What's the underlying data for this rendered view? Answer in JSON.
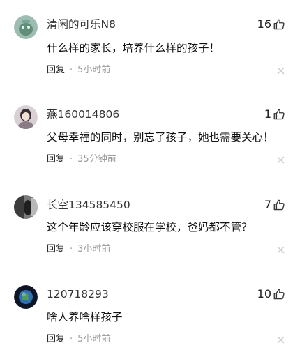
{
  "comments": [
    {
      "username": "清闲的可乐N8",
      "likes": "16",
      "text": "什么样的家长，培养什么样的孩子！",
      "reply_label": "回复",
      "separator": "·",
      "time": "5小时前",
      "avatar_color": "#8fb0a6"
    },
    {
      "username": "燕160014806",
      "likes": "1",
      "text": "父母幸福的同时，别忘了孩子，她也需要关心！",
      "reply_label": "回复",
      "separator": "·",
      "time": "35分钟前",
      "avatar_color": "#c9bfc4"
    },
    {
      "username": "长空134585450",
      "likes": "7",
      "text": "这个年龄应该穿校服在学校，爸妈都不管？",
      "reply_label": "回复",
      "separator": "·",
      "time": "3小时前",
      "avatar_color": "#4a4a4a"
    },
    {
      "username": "120718293",
      "likes": "10",
      "text": "啥人养啥样孩子",
      "reply_label": "回复",
      "separator": "·",
      "time": "5小时前",
      "avatar_color": "#1b2a4a"
    }
  ],
  "icons": {
    "like": "thumbs-up-icon",
    "dismiss": "close-icon"
  },
  "colors": {
    "text": "#111111",
    "secondary": "#999999",
    "icon": "#333333"
  }
}
